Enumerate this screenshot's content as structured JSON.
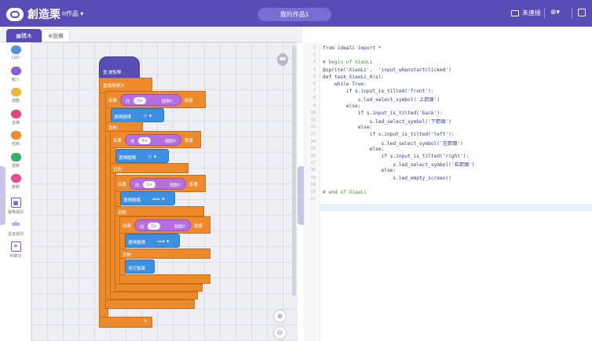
{
  "app": {
    "brand": "創造栗",
    "works_menu": "作品",
    "project_name": "我的作品1",
    "connection": "未連接",
    "lang_icon": "globe-icon",
    "save_icon": "save-icon"
  },
  "tabs": {
    "blocks": "積木",
    "device": "設備"
  },
  "categories": [
    {
      "label": "LED",
      "color": "#5a8fe0"
    },
    {
      "label": "輸入",
      "color": "#8a5cd6"
    },
    {
      "label": "運動",
      "color": "#f0b53c"
    },
    {
      "label": "音樂",
      "color": "#e0457b"
    },
    {
      "label": "控制",
      "color": "#ec8a2c"
    },
    {
      "label": "運算",
      "color": "#34b06a"
    },
    {
      "label": "變數",
      "color": "#e44d8a"
    },
    {
      "label": "圖像識別",
      "icon": "image-recognition-icon"
    },
    {
      "label": "語音識別",
      "icon": "voice-recognition-icon"
    },
    {
      "label": "AI算法",
      "icon": "ai-algorithm-icon"
    }
  ],
  "blocks": {
    "hat": "當 被點擊",
    "forever": "重複無限次",
    "if": "如果",
    "then": "那麼",
    "else": "否則",
    "tilt": "傾斜?",
    "dir_prefix": "向",
    "directions": [
      "前",
      "後",
      "左",
      "右"
    ],
    "select_icon": "選擇圖標",
    "clear": "清空螢幕"
  },
  "code": {
    "lines": [
      "from ideali import *",
      "",
      "# begin of XiaoLi",
      "@sprite('XiaoLi',  'input_whenstartclicked')",
      "def task_XiaoLi_0(s):",
      "    while True:",
      "        if s.input_is_tilted('front'):",
      "            s.led_select_symbol('上箭頭')",
      "        else:",
      "            if s.input_is_tilted('back'):",
      "                s.led_select_symbol('下箭頭')",
      "            else:",
      "                if s.input_is_tilted('left'):",
      "                    s.led_select_symbol('左箭頭')",
      "                else:",
      "                    if s.input_is_tilted('right'):",
      "                        s.led_select_symbol('右箭頭')",
      "                    else:",
      "                        s.led_empty_screen()",
      "",
      "# end of XiaoLi",
      ""
    ]
  }
}
